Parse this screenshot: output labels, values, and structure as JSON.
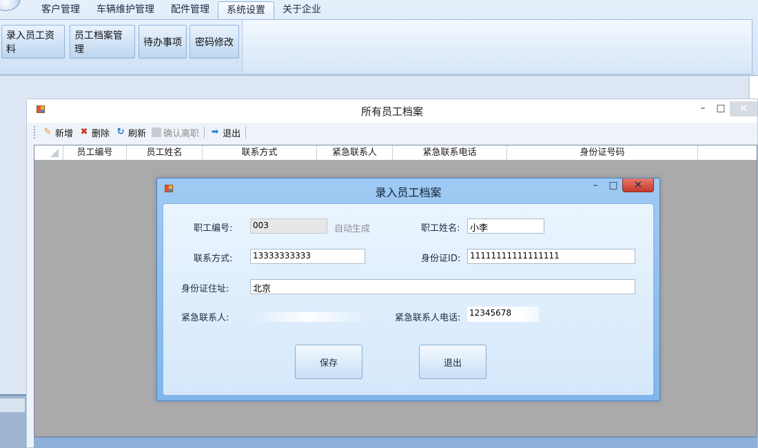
{
  "menu": {
    "tabs": [
      {
        "label": "客户管理"
      },
      {
        "label": "车辆维护管理"
      },
      {
        "label": "配件管理"
      },
      {
        "label": "系统设置"
      },
      {
        "label": "关于企业"
      }
    ],
    "active_tab": "系统设置"
  },
  "ribbon": {
    "buttons": [
      {
        "label": "录入员工资料"
      },
      {
        "label": "员工档案管理"
      },
      {
        "label": "待办事项"
      },
      {
        "label": "密码修改"
      }
    ]
  },
  "archive_window": {
    "title": "所有员工档案",
    "toolbar": {
      "add": "新增",
      "delete": "删除",
      "refresh": "刷新",
      "confirm_resign": "确认离职",
      "exit": "退出"
    },
    "grid_columns": [
      "员工编号",
      "员工姓名",
      "联系方式",
      "紧急联系人",
      "紧急联系电话",
      "身份证号码"
    ]
  },
  "dialog": {
    "title": "录入员工档案",
    "fields": {
      "emp_no_label": "职工编号:",
      "emp_no_value": "003",
      "auto_hint": "自动生成",
      "emp_name_label": "职工姓名:",
      "emp_name_value": "小李",
      "contact_label": "联系方式:",
      "contact_value": "13333333333",
      "id_label": "身份证ID:",
      "id_value": "11111111111111111",
      "address_label": "身份证住址:",
      "address_value": "北京",
      "emergency_contact_label": "紧急联系人:",
      "emergency_contact_value": "",
      "emergency_phone_label": "紧急联系人电话:",
      "emergency_phone_value": "12345678"
    },
    "save_label": "保存",
    "exit_label": "退出"
  },
  "colors": {
    "ribbon_bg": "#d3e3f5",
    "dialog_frame": "#8fbdee",
    "grid_bg": "#aaaaaa",
    "close_red": "#d2473a"
  }
}
